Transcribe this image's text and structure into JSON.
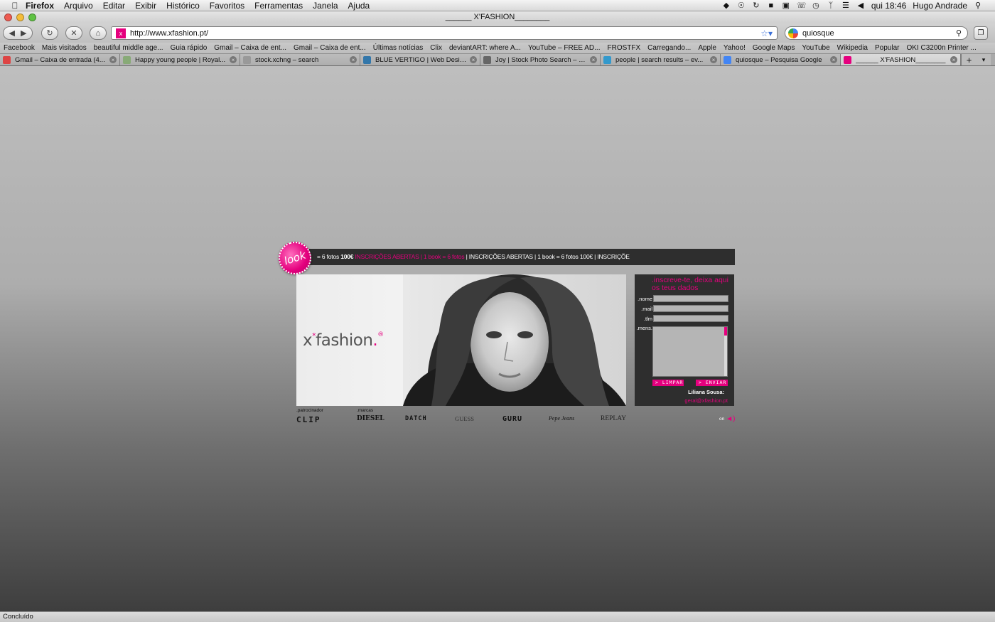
{
  "menubar": {
    "app": "Firefox",
    "items": [
      "Arquivo",
      "Editar",
      "Exibir",
      "Histórico",
      "Favoritos",
      "Ferramentas",
      "Janela",
      "Ajuda"
    ],
    "clock": "qui 18:46",
    "user": "Hugo Andrade"
  },
  "window": {
    "title": "______ X'FASHION________"
  },
  "toolbar": {
    "url": "http://www.xfashion.pt/",
    "search_value": "quiosque"
  },
  "bookmarks": [
    "Facebook",
    "Mais visitados",
    "beautiful middle age...",
    "Guia rápido",
    "Gmail – Caixa de ent...",
    "Gmail – Caixa de ent...",
    "Últimas notícias",
    "Clix",
    "deviantART: where A...",
    "YouTube – FREE AD...",
    "FROSTFX",
    "Carregando...",
    "Apple",
    "Yahoo!",
    "Google Maps",
    "YouTube",
    "Wikipedia",
    "Popular",
    "OKI C3200n Printer ..."
  ],
  "tabs": [
    {
      "label": "Gmail – Caixa de entrada (4...",
      "color": "#d44"
    },
    {
      "label": "Happy young people | Royal...",
      "color": "#8a7"
    },
    {
      "label": "stock.xchng – search",
      "color": "#999"
    },
    {
      "label": "BLUE VERTIGO | Web Design...",
      "color": "#37a"
    },
    {
      "label": "Joy | Stock Photo Search – s...",
      "color": "#666"
    },
    {
      "label": "people | search results – ev...",
      "color": "#39c"
    },
    {
      "label": "quiosque – Pesquisa Google",
      "color": "#4285f4"
    },
    {
      "label": "______ X'FASHION________",
      "color": "#e5007e"
    }
  ],
  "page": {
    "badge": "look",
    "ticker_white": "= 6 fotos",
    "ticker_price": "100€",
    "ticker_mid": "INSCRIÇÕES ABERTAS | 1 book = 6 fotos",
    "ticker_white2": "| INSCRIÇÕES ABERTAS | 1 book = 6 fotos",
    "ticker_end": "| INSCRIÇÕES ABERTAS | 1 book = 6 fotos 100€ | INSCRIÇÕE",
    "logo": "x",
    "logo_sup": "*",
    "logo_rest": "fashion",
    "logo_reg": "®",
    "form": {
      "heading": ".inscreve-te, deixa aqui os teus dados",
      "fields": [
        ".nome",
        ".mail",
        ".tlm",
        ".mens."
      ],
      "clear_label": "> LIMPAR",
      "send_label": "> ENVIAR",
      "contact_name": "Liliana Sousa:",
      "contact_mail": "geral@xfashion.pt"
    },
    "sponsors": {
      "sponsor_label": ".patrocinador",
      "brands_label": ".marcas",
      "brands": [
        "CLIP",
        "DIESEL",
        "DATCH",
        "GUESS",
        "GURU",
        "Pepe Jeans",
        "REPLAY"
      ],
      "sound_label": "on"
    }
  },
  "status": "Concluído",
  "colors": {
    "accent": "#e5007e",
    "panel": "#2e2e2e"
  }
}
